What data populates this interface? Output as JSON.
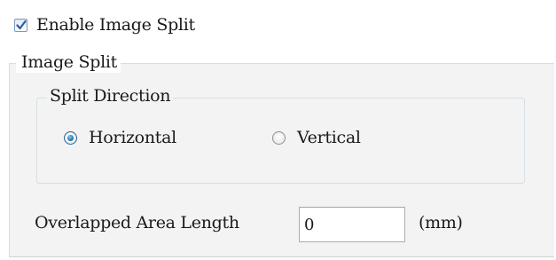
{
  "enable": {
    "label": "Enable Image Split",
    "checked": true
  },
  "image_split": {
    "title": "Image Split",
    "split_direction": {
      "title": "Split Direction",
      "options": [
        {
          "label": "Horizontal",
          "selected": true
        },
        {
          "label": "Vertical",
          "selected": false
        }
      ]
    },
    "overlap": {
      "label": "Overlapped Area Length",
      "value": "0",
      "unit": "(mm)"
    }
  },
  "colors": {
    "group_background": "#f3f3f3",
    "radio_selected": "#1f79b5",
    "checkbox_check": "#2a5ea4"
  }
}
